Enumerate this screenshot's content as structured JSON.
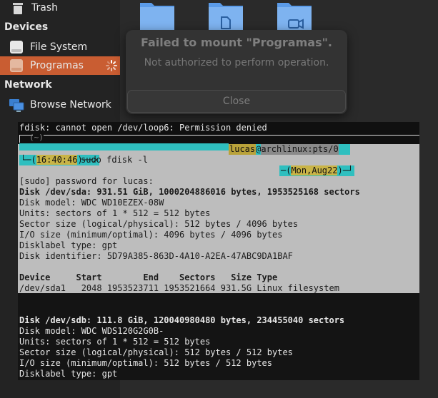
{
  "sidebar": {
    "trash_label": "Trash",
    "devices_heading": "Devices",
    "devices": [
      {
        "label": "File System",
        "icon": "drive-icon"
      },
      {
        "label": "Programas",
        "icon": "drive-icon",
        "selected": true
      }
    ],
    "network_heading": "Network",
    "browse_network_label": "Browse Network"
  },
  "notification": {
    "title": "Failed to mount \"Programas\".",
    "body": "Not authorized to perform operation.",
    "close_label": "Close"
  },
  "terminal": {
    "error_line": "fdisk: cannot open /dev/loop6: Permission denied",
    "prompt_tilde": "(~)",
    "prompt_user": "lucas",
    "prompt_at": "@",
    "prompt_host": "archlinux:pts/0",
    "prompt_time": "16:40:46",
    "command": "sudo fdisk -l",
    "prompt_date": "Mon,Aug22",
    "lines": [
      {
        "text": "[sudo] password for lucas:",
        "bold": false
      },
      {
        "text": "Disk /dev/sda: 931.51 GiB, 1000204886016 bytes, 1953525168 sectors",
        "bold": true
      },
      {
        "text": "Disk model: WDC WD10EZEX-08W",
        "bold": false
      },
      {
        "text": "Units: sectors of 1 * 512 = 512 bytes",
        "bold": false
      },
      {
        "text": "Sector size (logical/physical): 512 bytes / 4096 bytes",
        "bold": false
      },
      {
        "text": "I/O size (minimum/optimal): 4096 bytes / 4096 bytes",
        "bold": false
      },
      {
        "text": "Disklabel type: gpt",
        "bold": false
      },
      {
        "text": "Disk identifier: 5D79A385-863D-4A10-A2EA-47ABC9DA1BAF",
        "bold": false
      },
      {
        "text": "",
        "bold": false
      },
      {
        "text": "Device     Start        End    Sectors   Size Type",
        "bold": true
      },
      {
        "text": "/dev/sda1   2048 1953523711 1953521664 931.5G Linux filesystem",
        "bold": false
      }
    ],
    "lines2": [
      {
        "text": "Disk /dev/sdb: 111.8 GiB, 120040980480 bytes, 234455040 sectors",
        "bold": true
      },
      {
        "text": "Disk model: WDC WDS120G2G0B-",
        "bold": false
      },
      {
        "text": "Units: sectors of 1 * 512 = 512 bytes",
        "bold": false
      },
      {
        "text": "Sector size (logical/physical): 512 bytes / 512 bytes",
        "bold": false
      },
      {
        "text": "I/O size (minimum/optimal): 512 bytes / 512 bytes",
        "bold": false
      },
      {
        "text": "Disklabel type: gpt",
        "bold": false
      }
    ]
  },
  "colors": {
    "accent": "#c95d32",
    "terminal_cyan": "#2fbfbf",
    "terminal_yellow": "#c9b447"
  }
}
